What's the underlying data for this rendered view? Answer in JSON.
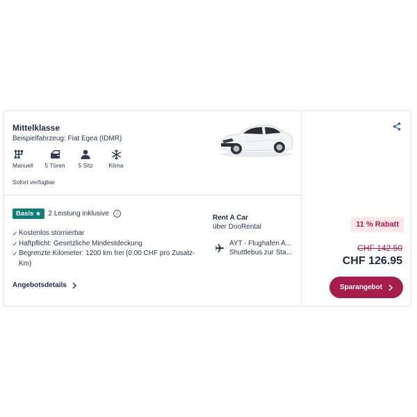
{
  "offer": {
    "car_class": "Mittelklasse",
    "example_vehicle": "Beispielfahrzeug: Fiat Egea (IDMR)",
    "features": [
      {
        "icon": "gear-shift-icon",
        "label": "Manuell"
      },
      {
        "icon": "car-door-icon",
        "label": "5 Türen"
      },
      {
        "icon": "person-icon",
        "label": "5 Sitz"
      },
      {
        "icon": "snowflake-icon",
        "label": "Klima"
      }
    ],
    "availability": "Sofort verfügbar",
    "package": {
      "badge": "Basis",
      "badge_color": "#0c7d78",
      "included_text": "2 Leistung inklusive"
    },
    "benefits": [
      "Kostenlos stornierbar",
      "Haftpflicht: Gesetzliche Mindestdeckung",
      "Begrenzte Kilometer: 1200 km frei (0.00 CHF pro Zusatz-Km)"
    ],
    "details_link": "Angebotsdetails",
    "vendor": {
      "name": "Rent A Car",
      "via": "über DooRental"
    },
    "location": {
      "line1": "AYT - Flughafen A...",
      "line2": "Shuttlebus zur Sta..."
    }
  },
  "pricing": {
    "discount": "11 % Rabatt",
    "old_price": "CHF 142.50",
    "new_price": "CHF 126.95",
    "cta_label": "Sparangebot",
    "accent_color": "#a61d4c"
  }
}
